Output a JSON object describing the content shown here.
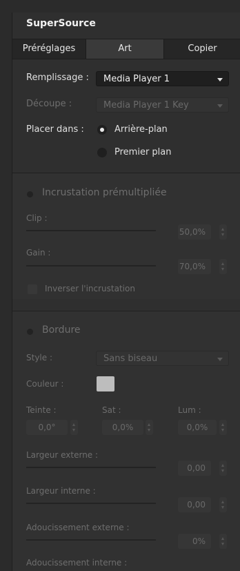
{
  "panel": {
    "title": "SuperSource"
  },
  "tabs": [
    {
      "label": "Préréglages",
      "selected": false
    },
    {
      "label": "Art",
      "selected": true
    },
    {
      "label": "Copier",
      "selected": false
    }
  ],
  "art": {
    "fill_label": "Remplissage :",
    "fill_value": "Media Player 1",
    "cut_label": "Découpe :",
    "cut_value": "Media Player 1 Key",
    "place_label": "Placer dans :",
    "place_options": [
      {
        "label": "Arrière-plan",
        "selected": true
      },
      {
        "label": "Premier plan",
        "selected": false
      }
    ]
  },
  "premult": {
    "title": "Incrustation prémultipliée",
    "clip_label": "Clip :",
    "clip_value": "50,0%",
    "gain_label": "Gain :",
    "gain_value": "70,0%",
    "invert_label": "Inverser l'incrustation"
  },
  "border": {
    "title": "Bordure",
    "style_label": "Style :",
    "style_value": "Sans biseau",
    "color_label": "Couleur :",
    "hue_label": "Teinte :",
    "hue_value": "0,0°",
    "sat_label": "Sat :",
    "sat_value": "0,0%",
    "lum_label": "Lum :",
    "lum_value": "0,0%",
    "outer_width_label": "Largeur externe :",
    "outer_width_value": "0,00",
    "inner_width_label": "Largeur interne :",
    "inner_width_value": "0,00",
    "outer_soft_label": "Adoucissement externe :",
    "outer_soft_value": "0%",
    "inner_soft_label": "Adoucissement interne :"
  },
  "colors": {
    "panel": "#2f2f2f",
    "field": "#1f1f1f",
    "disabled_text": "#6e6e6e",
    "swatch": "#bdbdbd"
  }
}
